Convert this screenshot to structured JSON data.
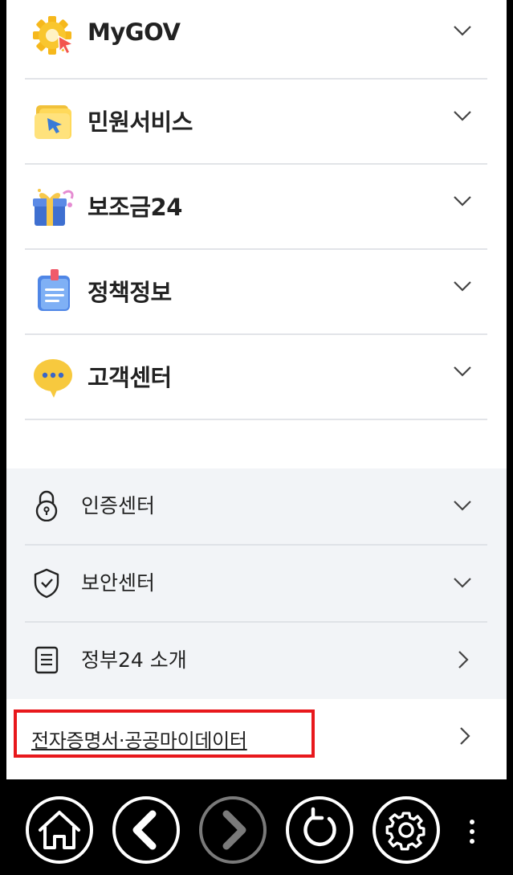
{
  "menu": {
    "main_items": [
      {
        "label": "MyGOV",
        "icon": "mygov-gear-icon"
      },
      {
        "label": "민원서비스",
        "icon": "folder-cursor-icon"
      },
      {
        "label": "보조금24",
        "icon": "gift-box-icon"
      },
      {
        "label": "정책정보",
        "icon": "document-clipboard-icon"
      },
      {
        "label": "고객센터",
        "icon": "speech-bubble-icon"
      }
    ],
    "sub_items": [
      {
        "label": "인증센터",
        "icon": "lock-icon"
      },
      {
        "label": "보안센터",
        "icon": "shield-check-icon"
      },
      {
        "label": "정부24 소개",
        "icon": "document-list-icon"
      }
    ],
    "link_item": {
      "label": "전자증명서·공공마이데이터",
      "icon": "chevron-right-icon"
    }
  },
  "colors": {
    "highlight": "#e8181c",
    "sub_section_bg": "#f2f4f7",
    "navbar_bg": "#000000"
  },
  "navbar": {
    "buttons": [
      {
        "name": "home",
        "icon": "home-icon"
      },
      {
        "name": "back",
        "icon": "back-arrow-icon"
      },
      {
        "name": "forward",
        "icon": "forward-arrow-icon",
        "state": "disabled"
      },
      {
        "name": "reload",
        "icon": "reload-icon"
      },
      {
        "name": "settings",
        "icon": "gear-icon"
      },
      {
        "name": "more",
        "icon": "more-vertical-icon"
      }
    ]
  }
}
